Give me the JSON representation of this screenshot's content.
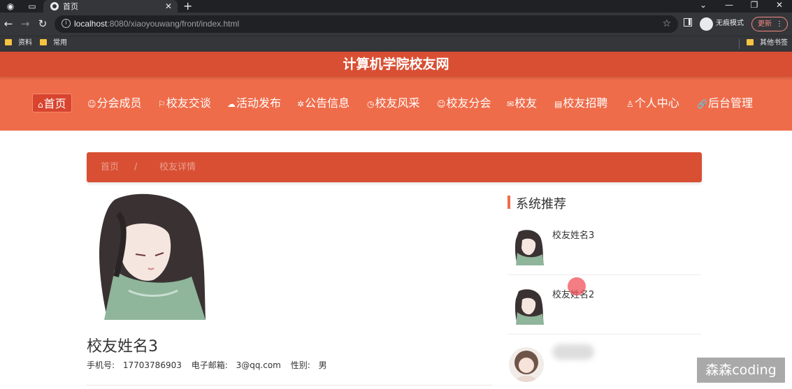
{
  "browser": {
    "tab_title": "首页",
    "url_host": "localhost",
    "url_rest": ":8080/xiaoyouwang/front/index.html",
    "incognito_label": "无痕模式",
    "update_label": "更新",
    "bookmarks": [
      "资料",
      "常用"
    ],
    "other_bookmarks": "其他书签"
  },
  "site": {
    "title": "计算机学院校友网",
    "nav": [
      "首页",
      "分会成员",
      "校友交谈",
      "活动发布",
      "公告信息",
      "校友风采",
      "校友分会",
      "校友",
      "校友招聘",
      "个人中心",
      "后台管理"
    ],
    "breadcrumb": {
      "home": "首页",
      "sep": "/",
      "current": "校友详情"
    }
  },
  "detail": {
    "name": "校友姓名3",
    "phone_label": "手机号:",
    "phone": "17703786903",
    "email_label": "电子邮箱:",
    "email": "3@qq.com",
    "gender_label": "性别:",
    "gender": "男"
  },
  "recommend": {
    "title": "系统推荐",
    "items": [
      {
        "name": "校友姓名3"
      },
      {
        "name": "校友姓名2"
      },
      {
        "name": ""
      }
    ]
  },
  "watermark": "森森coding",
  "colors": {
    "accent": "#ef6c4a",
    "accent_dark": "#d94f33"
  }
}
